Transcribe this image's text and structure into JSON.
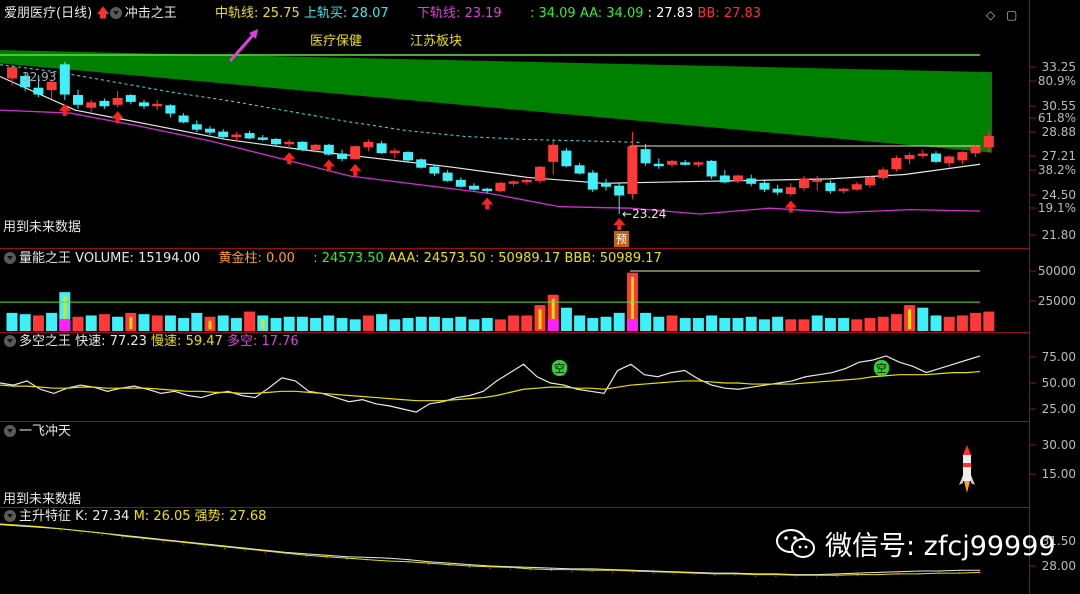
{
  "header": {
    "stock": "爱朋医疗",
    "period": "(日线)",
    "indicator": "冲击之王",
    "mid_label": "中轨线:",
    "mid_value": "25.75",
    "upper_label": "上轨买:",
    "upper_value": "28.07",
    "lower_label": "下轨线:",
    "lower_value": "23.19",
    "v1": ": 34.09",
    "aa_label": "AA:",
    "aa_value": "34.09",
    "v2": ": 27.83",
    "bb_label": "BB:",
    "bb_value": "27.83",
    "tag1": "医疗保健",
    "tag2": "江苏板块"
  },
  "notes": {
    "future_data_1": "用到未来数据",
    "future_data_2": "用到未来数据",
    "price_label_start": "32.93",
    "price_label_low": "23.24",
    "forecast_badge": "预"
  },
  "volume_panel": {
    "name": "量能之王",
    "vol_label": "VOLUME:",
    "vol_value": "15194.00",
    "gold_label": "黄金柱:",
    "gold_value": "0.00",
    "v1": ": 24573.50",
    "aaa_label": "AAA:",
    "aaa_value": "24573.50",
    "v2": ": 50989.17",
    "bbb_label": "BBB:",
    "bbb_value": "50989.17"
  },
  "duokong_panel": {
    "name": "多空之王",
    "fast_label": "快速:",
    "fast_value": "77.23",
    "slow_label": "慢速:",
    "slow_value": "59.47",
    "kong_label": "多空:",
    "kong_value": "17.76",
    "marker": "空"
  },
  "yifei_panel": {
    "name": "一飞冲天"
  },
  "zhusheng_panel": {
    "name": "主升特征",
    "k_label": "K:",
    "k_value": "27.34",
    "m_label": "M:",
    "m_value": "26.05",
    "strong_label": "强势:",
    "strong_value": "27.68"
  },
  "axes": {
    "main": [
      "33.25",
      "80.9%",
      "30.55",
      "61.8%",
      "28.88",
      "27.21",
      "38.2%",
      "24.50",
      "19.1%",
      "21.80"
    ],
    "volume": [
      "50000",
      "25000"
    ],
    "duokong": [
      "75.00",
      "50.00",
      "25.00"
    ],
    "yifei": [
      "30.00",
      "15.00"
    ],
    "zhusheng": [
      "31.50",
      "28.00"
    ]
  },
  "watermark": "微信号: zfcj99999",
  "colors": {
    "up": "#ff3838",
    "down": "#40f0f8",
    "channel": "#008000",
    "mid_line": "#e8e8e8",
    "lower_line": "#d030d0",
    "upper_dash": "#40e8f0",
    "yellow": "#e8e000",
    "magenta": "#ff20ff"
  },
  "chart_data": {
    "type": "candlestick",
    "candles": [
      [
        32.5,
        33.4,
        32.0,
        33.2
      ],
      [
        32.6,
        32.9,
        31.6,
        31.9
      ],
      [
        31.8,
        32.7,
        31.2,
        31.4
      ],
      [
        31.7,
        32.4,
        31.1,
        32.2
      ],
      [
        33.4,
        33.6,
        31.0,
        31.4
      ],
      [
        31.3,
        31.7,
        30.4,
        30.7
      ],
      [
        30.5,
        31.0,
        30.2,
        30.8
      ],
      [
        30.9,
        31.1,
        30.4,
        30.6
      ],
      [
        30.7,
        31.6,
        30.5,
        31.1
      ],
      [
        31.3,
        31.4,
        30.7,
        30.9
      ],
      [
        30.8,
        31.0,
        30.4,
        30.6
      ],
      [
        30.6,
        31.0,
        30.3,
        30.7
      ],
      [
        30.6,
        30.7,
        29.8,
        30.1
      ],
      [
        29.9,
        30.1,
        29.4,
        29.5
      ],
      [
        29.3,
        29.6,
        28.8,
        29.0
      ],
      [
        29.0,
        29.2,
        28.6,
        28.8
      ],
      [
        28.8,
        29.0,
        28.3,
        28.5
      ],
      [
        28.5,
        28.8,
        28.2,
        28.6
      ],
      [
        28.7,
        28.9,
        28.3,
        28.4
      ],
      [
        28.4,
        28.6,
        28.2,
        28.3
      ],
      [
        28.3,
        28.4,
        27.8,
        28.0
      ],
      [
        28.0,
        28.3,
        27.7,
        28.1
      ],
      [
        28.1,
        28.2,
        27.5,
        27.6
      ],
      [
        27.6,
        28.0,
        27.4,
        27.9
      ],
      [
        27.9,
        28.0,
        27.2,
        27.3
      ],
      [
        27.3,
        27.6,
        26.8,
        27.0
      ],
      [
        27.0,
        27.9,
        26.9,
        27.8
      ],
      [
        27.8,
        28.3,
        27.5,
        28.1
      ],
      [
        28.0,
        28.2,
        27.3,
        27.4
      ],
      [
        27.4,
        27.7,
        27.0,
        27.5
      ],
      [
        27.4,
        27.5,
        26.8,
        26.9
      ],
      [
        26.9,
        27.0,
        26.3,
        26.4
      ],
      [
        26.4,
        26.6,
        25.8,
        26.0
      ],
      [
        26.0,
        26.2,
        25.4,
        25.5
      ],
      [
        25.5,
        25.7,
        25.0,
        25.1
      ],
      [
        25.1,
        25.3,
        24.8,
        24.9
      ],
      [
        24.9,
        25.0,
        24.6,
        24.8
      ],
      [
        24.8,
        25.4,
        24.7,
        25.3
      ],
      [
        25.3,
        25.5,
        25.1,
        25.4
      ],
      [
        25.4,
        25.6,
        25.2,
        25.5
      ],
      [
        25.5,
        26.5,
        25.3,
        26.4
      ],
      [
        26.8,
        28.2,
        25.9,
        27.9
      ],
      [
        27.5,
        27.7,
        26.4,
        26.5
      ],
      [
        26.5,
        26.7,
        25.9,
        26.0
      ],
      [
        26.0,
        26.2,
        24.7,
        24.9
      ],
      [
        25.3,
        25.6,
        24.8,
        25.1
      ],
      [
        25.1,
        25.3,
        23.2,
        24.5
      ],
      [
        24.6,
        28.8,
        24.2,
        27.8
      ],
      [
        27.6,
        28.0,
        26.5,
        26.7
      ],
      [
        26.6,
        27.0,
        26.3,
        26.5
      ],
      [
        26.6,
        26.9,
        26.4,
        26.8
      ],
      [
        26.7,
        26.9,
        26.5,
        26.6
      ],
      [
        26.6,
        26.8,
        26.4,
        26.7
      ],
      [
        26.8,
        26.9,
        25.6,
        25.8
      ],
      [
        25.8,
        26.2,
        25.3,
        25.4
      ],
      [
        25.5,
        25.9,
        25.3,
        25.8
      ],
      [
        25.6,
        25.9,
        25.1,
        25.3
      ],
      [
        25.3,
        25.5,
        24.7,
        24.9
      ],
      [
        24.9,
        25.2,
        24.5,
        24.7
      ],
      [
        24.6,
        25.3,
        24.4,
        25.0
      ],
      [
        25.0,
        25.8,
        24.8,
        25.6
      ],
      [
        25.5,
        25.8,
        24.8,
        25.5
      ],
      [
        25.3,
        25.5,
        24.6,
        24.8
      ],
      [
        24.8,
        25.0,
        24.6,
        24.9
      ],
      [
        24.9,
        25.4,
        24.8,
        25.2
      ],
      [
        25.2,
        25.8,
        25.0,
        25.7
      ],
      [
        25.7,
        26.4,
        25.5,
        26.2
      ],
      [
        26.3,
        27.2,
        26.1,
        27.0
      ],
      [
        27.0,
        27.4,
        26.6,
        27.2
      ],
      [
        27.2,
        27.6,
        27.0,
        27.3
      ],
      [
        27.3,
        27.5,
        26.7,
        26.8
      ],
      [
        26.7,
        27.2,
        26.4,
        27.1
      ],
      [
        26.9,
        27.5,
        26.6,
        27.4
      ],
      [
        27.4,
        27.9,
        27.1,
        27.8
      ],
      [
        27.8,
        28.9,
        27.4,
        28.5
      ]
    ],
    "mid_line": [
      32.6,
      30.3,
      29.3,
      28.3,
      27.6,
      27.0,
      26.4,
      25.7,
      25.3,
      25.4,
      25.5,
      25.6,
      25.9,
      26.6
    ],
    "lower_line": [
      30.3,
      30.1,
      29.2,
      28.2,
      27.0,
      25.8,
      25.2,
      24.6,
      23.7,
      23.6,
      23.2,
      23.6,
      23.3,
      23.5,
      23.4
    ],
    "upper_dash": [
      33.4,
      32.9,
      32.2,
      31.5,
      30.9,
      30.2,
      29.5,
      28.9,
      28.5,
      28.3,
      28.2,
      28.1
    ],
    "channel_top": [
      34.4,
      32.9
    ],
    "channel_bottom": [
      33.5,
      27.4
    ],
    "buy_signals": [
      4,
      8,
      21,
      24,
      26,
      36,
      46,
      59
    ],
    "volume": [
      14,
      13,
      12,
      14,
      30,
      11,
      12,
      13,
      11,
      14,
      13,
      12,
      12,
      10,
      14,
      11,
      12,
      10,
      15,
      12,
      10,
      11,
      11,
      10,
      12,
      10,
      9,
      12,
      13,
      9,
      10,
      11,
      11,
      10,
      11,
      9,
      10,
      9,
      12,
      12,
      20,
      28,
      18,
      12,
      10,
      11,
      14,
      45,
      14,
      11,
      12,
      10,
      10,
      12,
      10,
      10,
      11,
      9,
      11,
      9,
      9,
      12,
      10,
      10,
      9,
      10,
      11,
      13,
      20,
      18,
      12,
      11,
      12,
      14,
      15
    ],
    "volume_up": [
      false,
      false,
      true,
      false,
      false,
      true,
      false,
      true,
      false,
      true,
      false,
      true,
      false,
      false,
      false,
      true,
      false,
      false,
      true,
      false,
      false,
      false,
      false,
      false,
      false,
      false,
      false,
      true,
      false,
      false,
      false,
      false,
      false,
      false,
      false,
      false,
      false,
      true,
      true,
      true,
      true,
      true,
      false,
      false,
      false,
      false,
      false,
      true,
      false,
      false,
      true,
      false,
      false,
      false,
      false,
      false,
      false,
      false,
      false,
      true,
      true,
      false,
      false,
      false,
      true,
      true,
      true,
      true,
      true,
      false,
      false,
      true,
      true,
      true,
      true
    ],
    "volume_lines": {
      "upper": 50989.17,
      "lower": 24573.5,
      "ymax": 62000
    },
    "fast_line": [
      50,
      48,
      52,
      44,
      40,
      45,
      48,
      46,
      42,
      45,
      47,
      44,
      40,
      42,
      38,
      36,
      40,
      42,
      38,
      36,
      45,
      55,
      52,
      42,
      40,
      36,
      32,
      34,
      30,
      28,
      25,
      22,
      30,
      32,
      36,
      38,
      42,
      52,
      60,
      68,
      56,
      50,
      48,
      44,
      42,
      40,
      62,
      68,
      58,
      56,
      60,
      62,
      54,
      48,
      45,
      44,
      46,
      48,
      50,
      52,
      56,
      58,
      60,
      64,
      70,
      72,
      76,
      70,
      66,
      60,
      64,
      68,
      72,
      76
    ],
    "slow_line": [
      48,
      47,
      47,
      46,
      45,
      45,
      46,
      46,
      45,
      45,
      45,
      45,
      44,
      43,
      42,
      42,
      41,
      41,
      40,
      40,
      41,
      42,
      42,
      41,
      40,
      39,
      38,
      37,
      36,
      35,
      34,
      33,
      33,
      33,
      34,
      35,
      36,
      38,
      41,
      44,
      45,
      46,
      46,
      45,
      45,
      44,
      46,
      48,
      49,
      50,
      51,
      52,
      52,
      51,
      50,
      50,
      49,
      49,
      49,
      49,
      50,
      51,
      52,
      53,
      54,
      56,
      57,
      58,
      58,
      58,
      59,
      60,
      60,
      61
    ],
    "k_line": [
      33.8,
      33.6,
      33.4,
      33.2,
      32.9,
      32.6,
      32.3,
      32.0,
      31.7,
      31.4,
      31.1,
      30.8,
      30.5,
      30.2,
      29.9,
      29.7,
      29.5,
      29.3,
      29.2,
      29.1,
      28.9,
      28.6,
      28.4,
      28.2,
      28.0,
      27.9,
      27.8,
      27.7,
      27.6,
      27.6,
      27.5,
      27.4,
      27.3,
      27.2,
      27.1,
      27.0,
      27.0,
      26.9,
      26.9,
      26.8,
      26.8,
      26.9,
      27.0,
      27.1,
      27.2,
      27.3,
      27.3,
      27.4,
      27.4
    ],
    "m_line": [
      33.9,
      33.7,
      33.5,
      33.2,
      32.9,
      32.6,
      32.2,
      31.9,
      31.6,
      31.3,
      31.0,
      30.7,
      30.4,
      30.1,
      29.8,
      29.5,
      29.3,
      29.1,
      28.9,
      28.7,
      28.6,
      28.4,
      28.2,
      28.0,
      27.9,
      27.8,
      27.6,
      27.5,
      27.5,
      27.4,
      27.4,
      27.3,
      27.2,
      27.1,
      27.0,
      26.9,
      26.9,
      26.8,
      26.8,
      26.7,
      26.7,
      26.7,
      26.8,
      26.8,
      26.9,
      26.9,
      27.0,
      27.0,
      27.1
    ]
  }
}
